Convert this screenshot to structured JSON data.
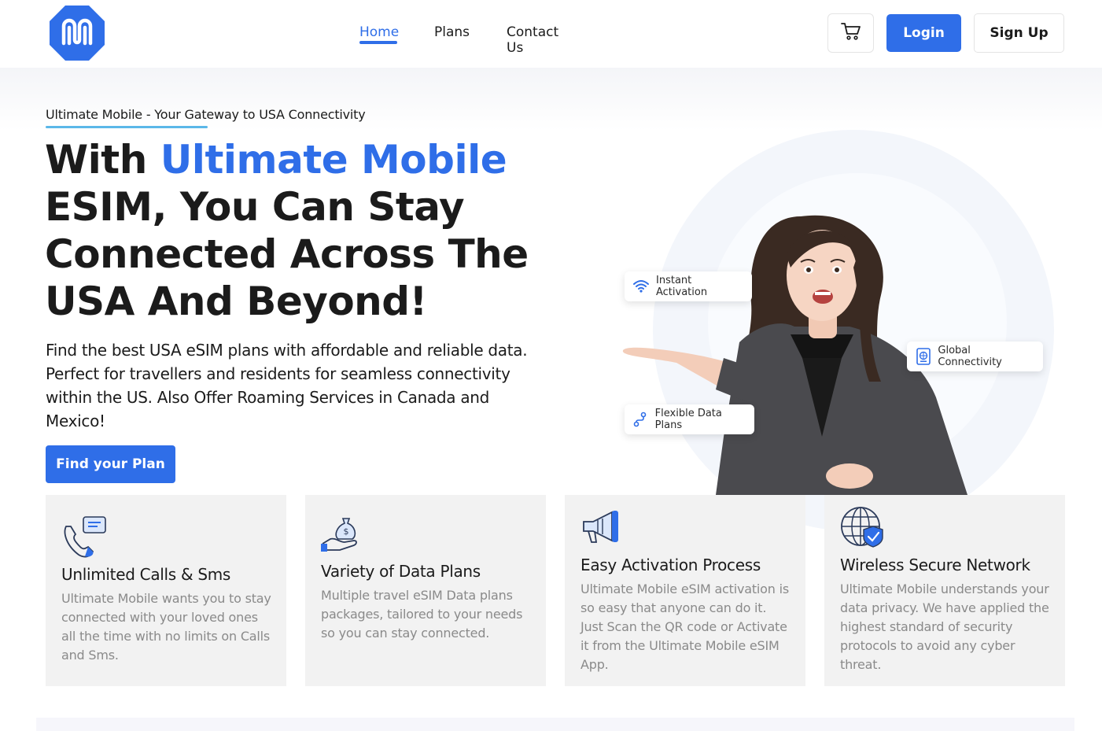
{
  "brand": {
    "logo_icon": "ultimate-mobile-logo",
    "accent": "#2f6ee8"
  },
  "nav": {
    "items": [
      {
        "label": "Home",
        "active": true
      },
      {
        "label": "Plans",
        "active": false
      },
      {
        "label": "Contact Us",
        "active": false
      }
    ],
    "cart_icon": "cart-icon",
    "login_label": "Login",
    "signup_label": "Sign Up"
  },
  "hero": {
    "eyebrow": "Ultimate Mobile - Your Gateway to USA Connectivity",
    "title_prefix": "With ",
    "title_accent": "Ultimate Mobile",
    "title_rest": "ESIM, You Can Stay Connected Across The USA And Beyond!",
    "description": "Find the best USA eSIM plans with affordable and reliable data. Perfect for travellers and residents for seamless connectivity within the US. Also Offer Roaming Services in Canada and Mexico!",
    "cta_label": "Find your Plan",
    "chips": [
      {
        "label": "Instant Activation",
        "icon": "wifi-icon"
      },
      {
        "label": "Global Connectivity",
        "icon": "passport-icon"
      },
      {
        "label": "Flexible Data Plans",
        "icon": "route-icon"
      }
    ]
  },
  "features": [
    {
      "title": "Unlimited Calls & Sms",
      "icon": "phone-chat-icon",
      "text": "Ultimate Mobile wants you to stay connected with your loved ones all the time with no limits on Calls and Sms."
    },
    {
      "title": "Variety of Data Plans",
      "icon": "money-bag-hand-icon",
      "text": "Multiple travel eSIM Data plans packages, tailored to your needs so you can stay connected."
    },
    {
      "title": "Easy Activation Process",
      "icon": "megaphone-icon",
      "text": "Ultimate Mobile eSIM activation is so easy that anyone can do it. Just Scan the QR code or Activate it from the Ultimate Mobile eSIM App."
    },
    {
      "title": "Wireless Secure Network",
      "icon": "globe-shield-icon",
      "text": "Ultimate Mobile understands your data privacy. We have applied the highest standard of security protocols to avoid any cyber threat."
    }
  ]
}
